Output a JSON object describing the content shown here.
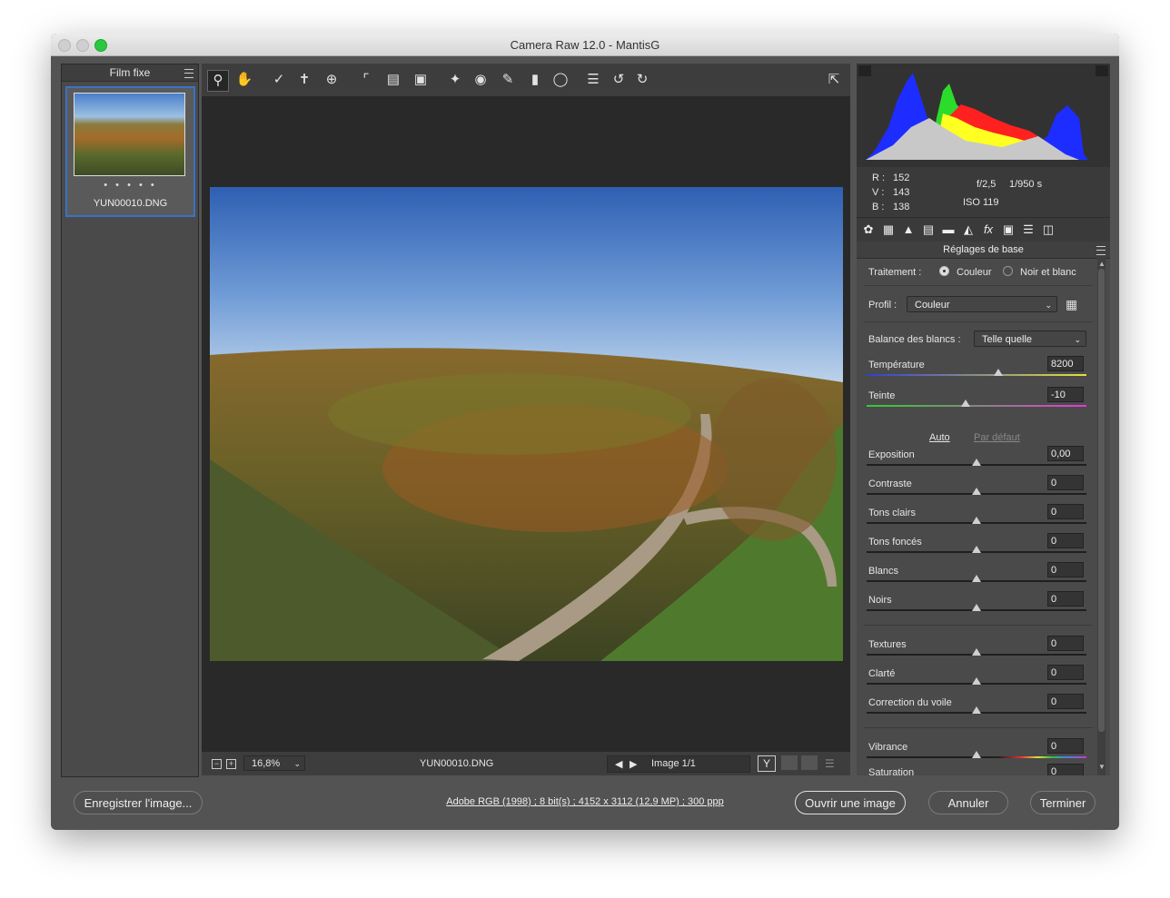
{
  "window": {
    "title": "Camera Raw 12.0  -  MantisG"
  },
  "filmstrip": {
    "header": "Film fixe",
    "dots": "• • • • •",
    "thumbnail_name": "YUN00010.DNG"
  },
  "toolbar": {
    "tools": [
      "zoom-tool",
      "hand-tool",
      "white-balance-tool",
      "color-sampler-tool",
      "targeted-adjustment-tool",
      "crop-tool",
      "straighten-tool",
      "transform-tool",
      "spot-removal-tool",
      "red-eye-tool",
      "adjustment-brush-tool",
      "graduated-filter-tool",
      "radial-filter-tool",
      "preferences-tool",
      "rotate-left-tool",
      "rotate-right-tool"
    ]
  },
  "status": {
    "zoom": "16,8%",
    "filename": "YUN00010.DNG",
    "image_count": "Image 1/1"
  },
  "histogram": {
    "colors": {
      "blue": "#1d2dff",
      "green": "#2bdc2b",
      "red": "#ff2020",
      "yellow": "#ffff22",
      "cyan": "#5bd6ff",
      "gray": "#c8c8c8"
    }
  },
  "info": {
    "r_label": "R :",
    "r": "152",
    "v_label": "V :",
    "v": "143",
    "b_label": "B :",
    "b": "138",
    "aperture": "f/2,5",
    "shutter": "1/950 s",
    "iso": "ISO 119"
  },
  "panel": {
    "section_title": "Réglages de base",
    "treatment_label": "Traitement :",
    "treatment_color": "Couleur",
    "treatment_bw": "Noir et blanc",
    "profile_label": "Profil :",
    "profile_value": "Couleur",
    "wb_label": "Balance des blancs :",
    "wb_value": "Telle quelle",
    "auto": "Auto",
    "default": "Par défaut",
    "sliders": [
      {
        "label": "Température",
        "value": "8200",
        "pos": 0.6
      },
      {
        "label": "Teinte",
        "value": "-10",
        "pos": 0.45
      },
      {
        "label": "Exposition",
        "value": "0,00",
        "pos": 0.5
      },
      {
        "label": "Contraste",
        "value": "0",
        "pos": 0.5
      },
      {
        "label": "Tons clairs",
        "value": "0",
        "pos": 0.5
      },
      {
        "label": "Tons foncés",
        "value": "0",
        "pos": 0.5
      },
      {
        "label": "Blancs",
        "value": "0",
        "pos": 0.5
      },
      {
        "label": "Noirs",
        "value": "0",
        "pos": 0.5
      },
      {
        "label": "Textures",
        "value": "0",
        "pos": 0.5
      },
      {
        "label": "Clarté",
        "value": "0",
        "pos": 0.5
      },
      {
        "label": "Correction du voile",
        "value": "0",
        "pos": 0.5
      },
      {
        "label": "Vibrance",
        "value": "0",
        "pos": 0.5
      },
      {
        "label": "Saturation",
        "value": "0",
        "pos": 0.5
      }
    ]
  },
  "footer": {
    "save": "Enregistrer l'image...",
    "meta": "Adobe RGB (1998) ; 8 bit(s) ; 4152 x 3112 (12,9 MP) ; 300 ppp",
    "open": "Ouvrir une image",
    "cancel": "Annuler",
    "done": "Terminer"
  }
}
